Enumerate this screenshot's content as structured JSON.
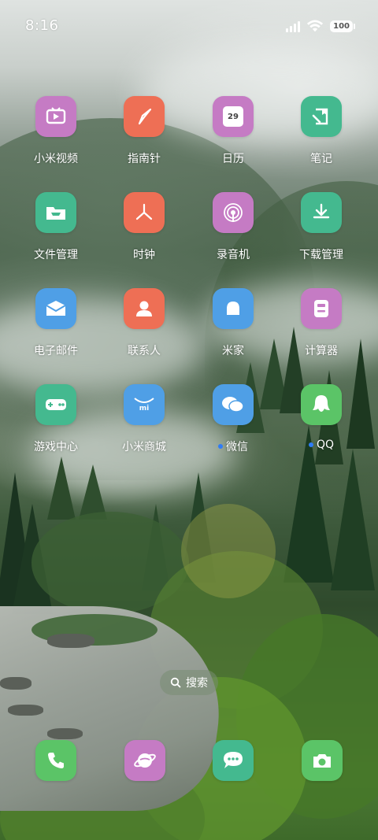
{
  "status_bar": {
    "time": "8:16",
    "battery": "100",
    "icons": [
      "signal-icon",
      "wifi-icon",
      "battery-icon"
    ]
  },
  "apps": [
    {
      "label": "小米视频",
      "icon": "video-icon",
      "color": "#c57bc4"
    },
    {
      "label": "指南针",
      "icon": "compass-icon",
      "color": "#ee6f55"
    },
    {
      "label": "日历",
      "icon": "calendar-icon",
      "color": "#c57bc4",
      "icon_text": "29"
    },
    {
      "label": "笔记",
      "icon": "notes-icon",
      "color": "#44b98f"
    },
    {
      "label": "文件管理",
      "icon": "folder-icon",
      "color": "#44b98f"
    },
    {
      "label": "时钟",
      "icon": "clock-icon",
      "color": "#ee6f55"
    },
    {
      "label": "录音机",
      "icon": "recorder-icon",
      "color": "#c57bc4"
    },
    {
      "label": "下载管理",
      "icon": "download-icon",
      "color": "#44b98f"
    },
    {
      "label": "电子邮件",
      "icon": "mail-icon",
      "color": "#4f9fe6"
    },
    {
      "label": "联系人",
      "icon": "contacts-icon",
      "color": "#ee6f55"
    },
    {
      "label": "米家",
      "icon": "mijia-icon",
      "color": "#4f9fe6"
    },
    {
      "label": "计算器",
      "icon": "calculator-icon",
      "color": "#c57bc4"
    },
    {
      "label": "游戏中心",
      "icon": "gamepad-icon",
      "color": "#44b98f"
    },
    {
      "label": "小米商城",
      "icon": "mi-store-icon",
      "color": "#4f9fe6",
      "icon_text": "mi"
    },
    {
      "label": "微信",
      "icon": "wechat-icon",
      "color": "#4f9fe6",
      "badge": true
    },
    {
      "label": "QQ",
      "icon": "qq-icon",
      "color": "#5bc467",
      "badge": true
    }
  ],
  "search": {
    "label": "搜索"
  },
  "dock": [
    {
      "icon": "phone-icon",
      "color": "#5bc467"
    },
    {
      "icon": "browser-icon",
      "color": "#c57bc4"
    },
    {
      "icon": "messages-icon",
      "color": "#44b98f"
    },
    {
      "icon": "camera-icon",
      "color": "#5bc467"
    }
  ]
}
